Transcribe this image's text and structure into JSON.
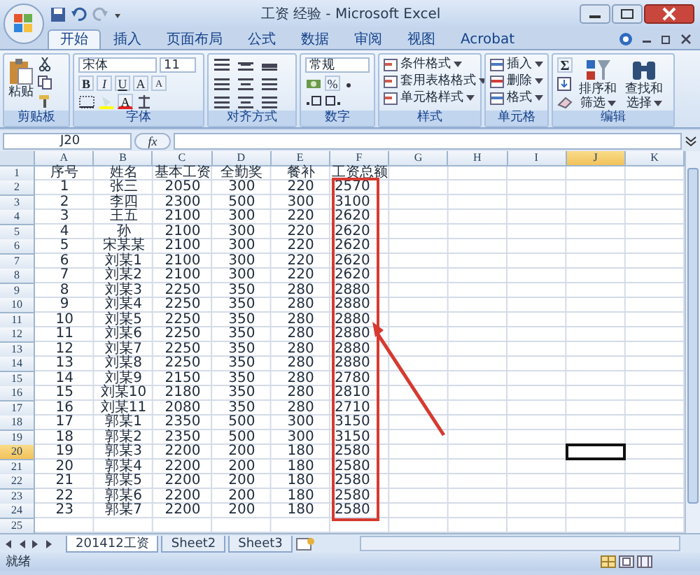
{
  "window": {
    "title": "工资 经验 - Microsoft Excel"
  },
  "tabs": [
    {
      "label": "开始",
      "selected": true
    },
    {
      "label": "插入",
      "selected": false
    },
    {
      "label": "页面布局",
      "selected": false
    },
    {
      "label": "公式",
      "selected": false
    },
    {
      "label": "数据",
      "selected": false
    },
    {
      "label": "审阅",
      "selected": false
    },
    {
      "label": "视图",
      "selected": false
    },
    {
      "label": "Acrobat",
      "selected": false
    }
  ],
  "ribbon": {
    "clipboard": {
      "label": "剪贴板",
      "paste": "粘贴"
    },
    "font": {
      "label": "字体",
      "font_name": "宋体",
      "font_size": "11",
      "bold": "B",
      "italic": "I",
      "underline": "U",
      "grow": "A",
      "shrink": "A",
      "font_color": "A"
    },
    "alignment": {
      "label": "对齐方式"
    },
    "number": {
      "label": "数字",
      "format": "常规",
      "percent": "%"
    },
    "styles": {
      "label": "样式",
      "commands": [
        "条件格式",
        "套用表格格式",
        "单元格样式"
      ]
    },
    "cells": {
      "label": "单元格",
      "commands": [
        "插入",
        "删除",
        "格式"
      ]
    },
    "editing": {
      "label": "编辑",
      "sum": "Σ",
      "commands": [
        {
          "line1": "排序和",
          "line2": "筛选"
        },
        {
          "line1": "查找和",
          "line2": "选择"
        }
      ]
    }
  },
  "formula_bar": {
    "name_box": "J20",
    "fx": "fx"
  },
  "columns": [
    {
      "label": "A",
      "selected": false
    },
    {
      "label": "B",
      "selected": false
    },
    {
      "label": "C",
      "selected": false
    },
    {
      "label": "D",
      "selected": false
    },
    {
      "label": "E",
      "selected": false
    },
    {
      "label": "F",
      "selected": false
    },
    {
      "label": "G",
      "selected": false
    },
    {
      "label": "H",
      "selected": false
    },
    {
      "label": "I",
      "selected": false
    },
    {
      "label": "J",
      "selected": true
    },
    {
      "label": "K",
      "selected": false
    }
  ],
  "rows": [
    {
      "number": "1",
      "selected": false,
      "cells": [
        "序号",
        "姓名",
        "基本工资",
        "全勤奖",
        "餐补",
        "工资总额"
      ]
    },
    {
      "number": "2",
      "selected": false,
      "cells": [
        "1",
        "张三",
        "2050",
        "300",
        "220",
        "2570"
      ]
    },
    {
      "number": "3",
      "selected": false,
      "cells": [
        "2",
        "李四",
        "2300",
        "500",
        "300",
        "3100"
      ]
    },
    {
      "number": "4",
      "selected": false,
      "cells": [
        "3",
        "王五",
        "2100",
        "300",
        "220",
        "2620"
      ]
    },
    {
      "number": "5",
      "selected": false,
      "cells": [
        "4",
        "孙",
        "2100",
        "300",
        "220",
        "2620"
      ]
    },
    {
      "number": "6",
      "selected": false,
      "cells": [
        "5",
        "宋某某",
        "2100",
        "300",
        "220",
        "2620"
      ]
    },
    {
      "number": "7",
      "selected": false,
      "cells": [
        "6",
        "刘某1",
        "2100",
        "300",
        "220",
        "2620"
      ]
    },
    {
      "number": "8",
      "selected": false,
      "cells": [
        "7",
        "刘某2",
        "2100",
        "300",
        "220",
        "2620"
      ]
    },
    {
      "number": "9",
      "selected": false,
      "cells": [
        "8",
        "刘某3",
        "2250",
        "350",
        "280",
        "2880"
      ]
    },
    {
      "number": "10",
      "selected": false,
      "cells": [
        "9",
        "刘某4",
        "2250",
        "350",
        "280",
        "2880"
      ]
    },
    {
      "number": "11",
      "selected": false,
      "cells": [
        "10",
        "刘某5",
        "2250",
        "350",
        "280",
        "2880"
      ]
    },
    {
      "number": "12",
      "selected": false,
      "cells": [
        "11",
        "刘某6",
        "2250",
        "350",
        "280",
        "2880"
      ]
    },
    {
      "number": "13",
      "selected": false,
      "cells": [
        "12",
        "刘某7",
        "2250",
        "350",
        "280",
        "2880"
      ]
    },
    {
      "number": "14",
      "selected": false,
      "cells": [
        "13",
        "刘某8",
        "2250",
        "350",
        "280",
        "2880"
      ]
    },
    {
      "number": "15",
      "selected": false,
      "cells": [
        "14",
        "刘某9",
        "2150",
        "350",
        "280",
        "2780"
      ]
    },
    {
      "number": "16",
      "selected": false,
      "cells": [
        "15",
        "刘某10",
        "2180",
        "350",
        "280",
        "2810"
      ]
    },
    {
      "number": "17",
      "selected": false,
      "cells": [
        "16",
        "刘某11",
        "2080",
        "350",
        "280",
        "2710"
      ]
    },
    {
      "number": "18",
      "selected": false,
      "cells": [
        "17",
        "郭某1",
        "2350",
        "500",
        "300",
        "3150"
      ]
    },
    {
      "number": "19",
      "selected": false,
      "cells": [
        "18",
        "郭某2",
        "2350",
        "500",
        "300",
        "3150"
      ]
    },
    {
      "number": "20",
      "selected": true,
      "cells": [
        "19",
        "郭某3",
        "2200",
        "200",
        "180",
        "2580"
      ]
    },
    {
      "number": "21",
      "selected": false,
      "cells": [
        "20",
        "郭某4",
        "2200",
        "200",
        "180",
        "2580"
      ]
    },
    {
      "number": "22",
      "selected": false,
      "cells": [
        "21",
        "郭某5",
        "2200",
        "200",
        "180",
        "2580"
      ]
    },
    {
      "number": "23",
      "selected": false,
      "cells": [
        "22",
        "郭某6",
        "2200",
        "200",
        "180",
        "2580"
      ]
    },
    {
      "number": "24",
      "selected": false,
      "cells": [
        "23",
        "郭某7",
        "2200",
        "200",
        "180",
        "2580"
      ]
    },
    {
      "number": "25",
      "selected": false,
      "cells": []
    }
  ],
  "sheet_tabs": [
    {
      "label": "201412工资",
      "selected": true
    },
    {
      "label": "Sheet2",
      "selected": false
    },
    {
      "label": "Sheet3",
      "selected": false
    }
  ],
  "status_bar": {
    "text": "就绪"
  }
}
